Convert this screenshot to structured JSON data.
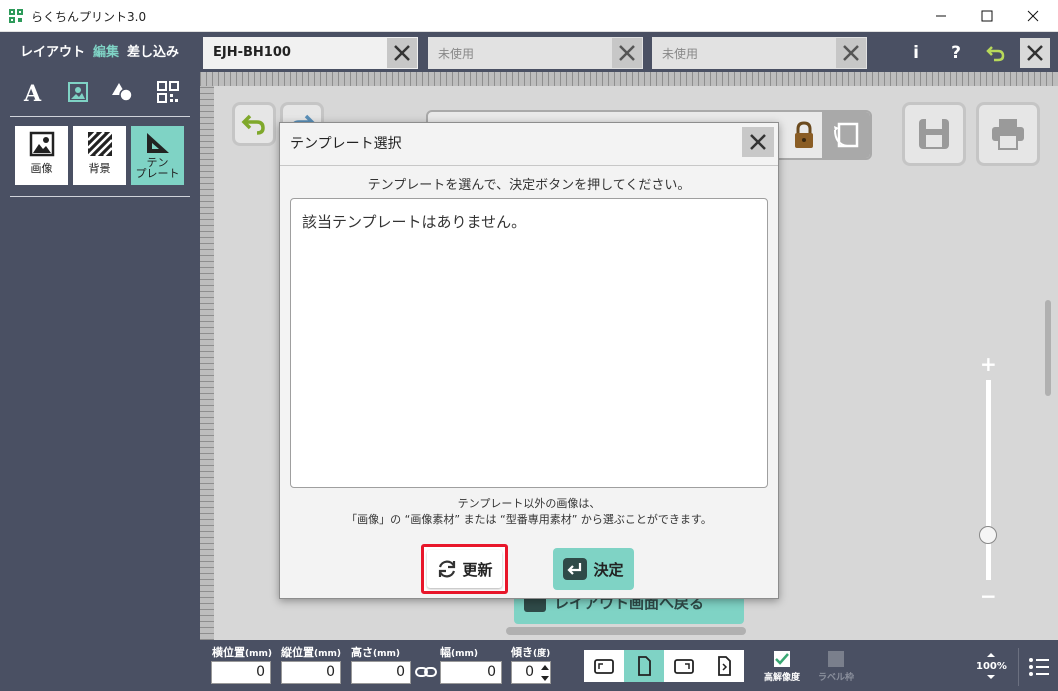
{
  "window": {
    "title": "らくちんプリント3.0"
  },
  "left_panel": {
    "mode_tabs": [
      {
        "label": "レイアウト",
        "active": false
      },
      {
        "label": "編集",
        "active": true
      },
      {
        "label": "差し込み",
        "active": false
      }
    ],
    "tools": [
      "text-icon",
      "image-icon",
      "shapes-icon",
      "qrcode-icon"
    ],
    "tiles": [
      {
        "label": "画像",
        "icon": "photo-icon",
        "active": false
      },
      {
        "label": "背景",
        "icon": "stripes-icon",
        "active": false
      },
      {
        "label": "テン\nプレート",
        "icon": "ruler-triangle-icon",
        "active": true
      }
    ]
  },
  "doc_tabs": [
    {
      "label": "EJH-BH100",
      "active": true
    },
    {
      "label": "未使用",
      "active": false
    },
    {
      "label": "未使用",
      "active": false
    }
  ],
  "header_icons": {
    "info": "i",
    "help": "?"
  },
  "canvas": {
    "back_button_label": "レイアウト画面へ戻る"
  },
  "modal": {
    "title": "テンプレート選択",
    "instruction": "テンプレートを選んで、決定ボタンを押してください。",
    "empty_message": "該当テンプレートはありません。",
    "note_line1": "テンプレート以外の画像は、",
    "note_line2": "「画像」の “画像素材” または “型番専用素材” から選ぶことができます。",
    "refresh_label": "更新",
    "ok_label": "決定"
  },
  "bottom_bar": {
    "fields": [
      {
        "label": "横位置",
        "unit": "(mm)",
        "value": "0"
      },
      {
        "label": "縦位置",
        "unit": "(mm)",
        "value": "0"
      },
      {
        "label": "高さ",
        "unit": "(mm)",
        "value": "0"
      },
      {
        "label": "幅",
        "unit": "(mm)",
        "value": "0"
      },
      {
        "label": "傾き",
        "unit": "(度)",
        "value": "0"
      }
    ],
    "high_res_label": "高解像度",
    "label_frame_label": "ラベル枠",
    "zoom_value": "100%"
  },
  "colors": {
    "accent": "#7fd3c5",
    "panel": "#4a5063",
    "highlight": "#e8162a"
  }
}
